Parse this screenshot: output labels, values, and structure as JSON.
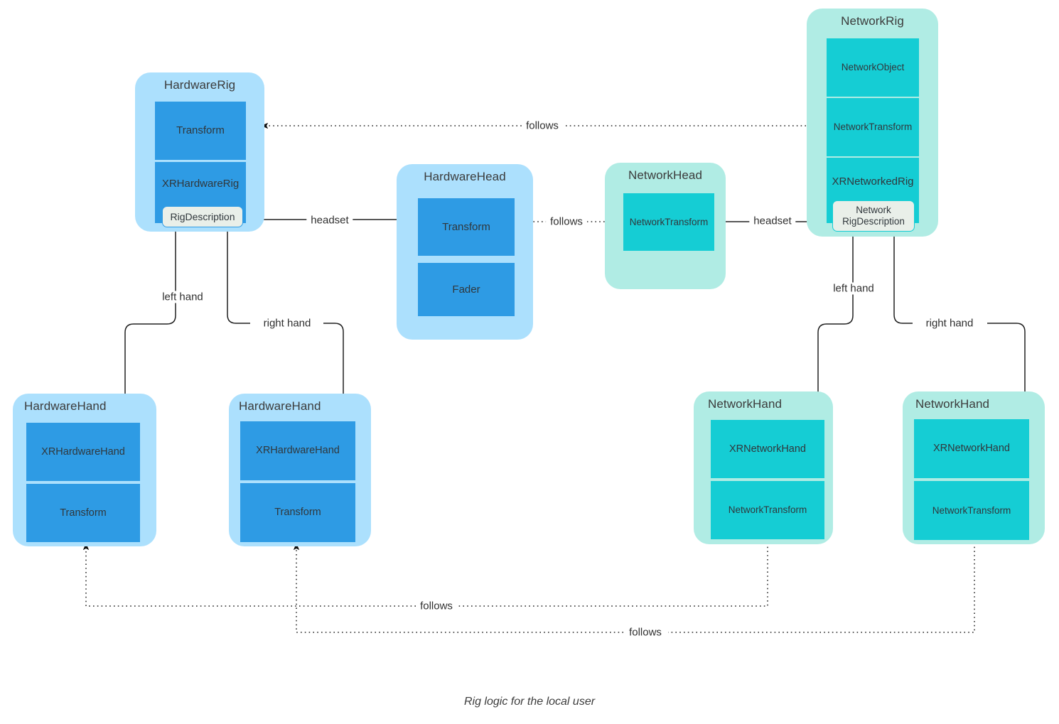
{
  "diagram": {
    "caption": "Rig logic for the local user",
    "colors": {
      "hardware_group_bg": "#ace0fd",
      "hardware_component_bg": "#2e9be4",
      "network_group_bg": "#b0ece4",
      "network_component_bg": "#15cdd4",
      "badge_bg": "#e9efe9",
      "edge": "#202020",
      "text": "#30373c"
    },
    "groups": [
      {
        "id": "hardware-rig",
        "title": "HardwareRig",
        "kind": "hardware",
        "components": [
          {
            "label": "Transform"
          },
          {
            "label": "XRHardwareRig"
          }
        ],
        "badge": {
          "label": "RigDescription",
          "lines": [
            "RigDescription"
          ]
        }
      },
      {
        "id": "hardware-head",
        "title": "HardwareHead",
        "kind": "hardware",
        "components": [
          {
            "label": "Transform"
          },
          {
            "label": "Fader"
          }
        ]
      },
      {
        "id": "network-head",
        "title": "NetworkHead",
        "kind": "network",
        "components": [
          {
            "label": "NetworkTransform"
          }
        ]
      },
      {
        "id": "network-rig",
        "title": "NetworkRig",
        "kind": "network",
        "components": [
          {
            "label": "NetworkObject"
          },
          {
            "label": "NetworkTransform"
          },
          {
            "label": "XRNetworkedRig"
          }
        ],
        "badge": {
          "label": "Network RigDescription",
          "lines": [
            "Network",
            "RigDescription"
          ]
        }
      },
      {
        "id": "hardware-hand-left",
        "title": "HardwareHand",
        "kind": "hardware",
        "components": [
          {
            "label": "XRHardwareHand"
          },
          {
            "label": "Transform"
          }
        ]
      },
      {
        "id": "hardware-hand-right",
        "title": "HardwareHand",
        "kind": "hardware",
        "components": [
          {
            "label": "XRHardwareHand"
          },
          {
            "label": "Transform"
          }
        ]
      },
      {
        "id": "network-hand-left",
        "title": "NetworkHand",
        "kind": "network",
        "components": [
          {
            "label": "XRNetworkHand"
          },
          {
            "label": "NetworkTransform"
          }
        ]
      },
      {
        "id": "network-hand-right",
        "title": "NetworkHand",
        "kind": "network",
        "components": [
          {
            "label": "XRNetworkHand"
          },
          {
            "label": "NetworkTransform"
          }
        ]
      }
    ],
    "edges": [
      {
        "id": "rig-follows",
        "label": "follows",
        "style": "dotted"
      },
      {
        "id": "hw-rig-headset",
        "label": "headset",
        "style": "solid"
      },
      {
        "id": "head-follows",
        "label": "follows",
        "style": "dotted"
      },
      {
        "id": "net-rig-headset",
        "label": "headset",
        "style": "solid"
      },
      {
        "id": "hw-left-hand",
        "label": "left hand",
        "style": "solid"
      },
      {
        "id": "hw-right-hand",
        "label": "right hand",
        "style": "solid"
      },
      {
        "id": "net-left-hand",
        "label": "left hand",
        "style": "solid"
      },
      {
        "id": "net-right-hand",
        "label": "right hand",
        "style": "solid"
      },
      {
        "id": "hand-left-follows",
        "label": "follows",
        "style": "dotted"
      },
      {
        "id": "hand-right-follows",
        "label": "follows",
        "style": "dotted"
      }
    ]
  }
}
